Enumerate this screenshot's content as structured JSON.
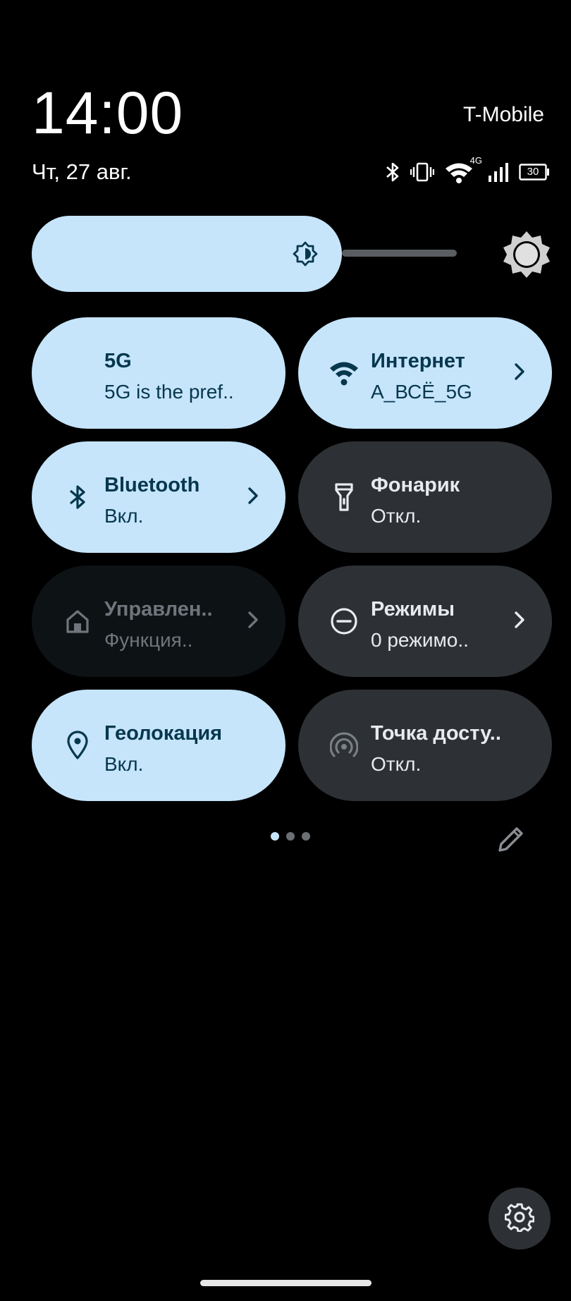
{
  "status": {
    "time": "14:00",
    "date": "Чт, 27 авг.",
    "carrier": "T-Mobile",
    "network_badge": "4G",
    "battery": "30",
    "icons": [
      "bluetooth-icon",
      "vibrate-icon",
      "wifi-icon",
      "signal-icon",
      "battery-icon"
    ]
  },
  "brightness": {
    "icon": "brightness-icon",
    "level": 0.59,
    "auto_icon": "auto-brightness-icon"
  },
  "tiles": [
    {
      "title": "5G",
      "subtitle": "5G is the pref..",
      "state": "on",
      "icon": "none",
      "chevron": false
    },
    {
      "title": "Интернет",
      "subtitle": "A_ВСЁ_5G",
      "state": "on",
      "icon": "wifi-icon",
      "chevron": true
    },
    {
      "title": "Bluetooth",
      "subtitle": "Вкл.",
      "state": "on",
      "icon": "bluetooth-icon",
      "chevron": true
    },
    {
      "title": "Фонарик",
      "subtitle": "Откл.",
      "state": "off",
      "icon": "flashlight-icon",
      "chevron": false
    },
    {
      "title": "Управлен..",
      "subtitle": "Функция..",
      "state": "disabled",
      "icon": "home-icon",
      "chevron": true
    },
    {
      "title": "Режимы",
      "subtitle": "0 режимо..",
      "state": "off",
      "icon": "do-not-disturb-icon",
      "chevron": true
    },
    {
      "title": "Геолокация",
      "subtitle": "Вкл.",
      "state": "on",
      "icon": "location-pin-icon",
      "chevron": false
    },
    {
      "title": "Точка досту..",
      "subtitle": "Откл.",
      "state": "off",
      "icon": "hotspot-icon",
      "chevron": false
    }
  ],
  "pager": {
    "pages": 3,
    "current": 1
  },
  "colors": {
    "tile_on": "#c6e5fb",
    "tile_off": "#2d3135",
    "tile_disabled": "#0d1215",
    "text_on": "#06374d"
  }
}
